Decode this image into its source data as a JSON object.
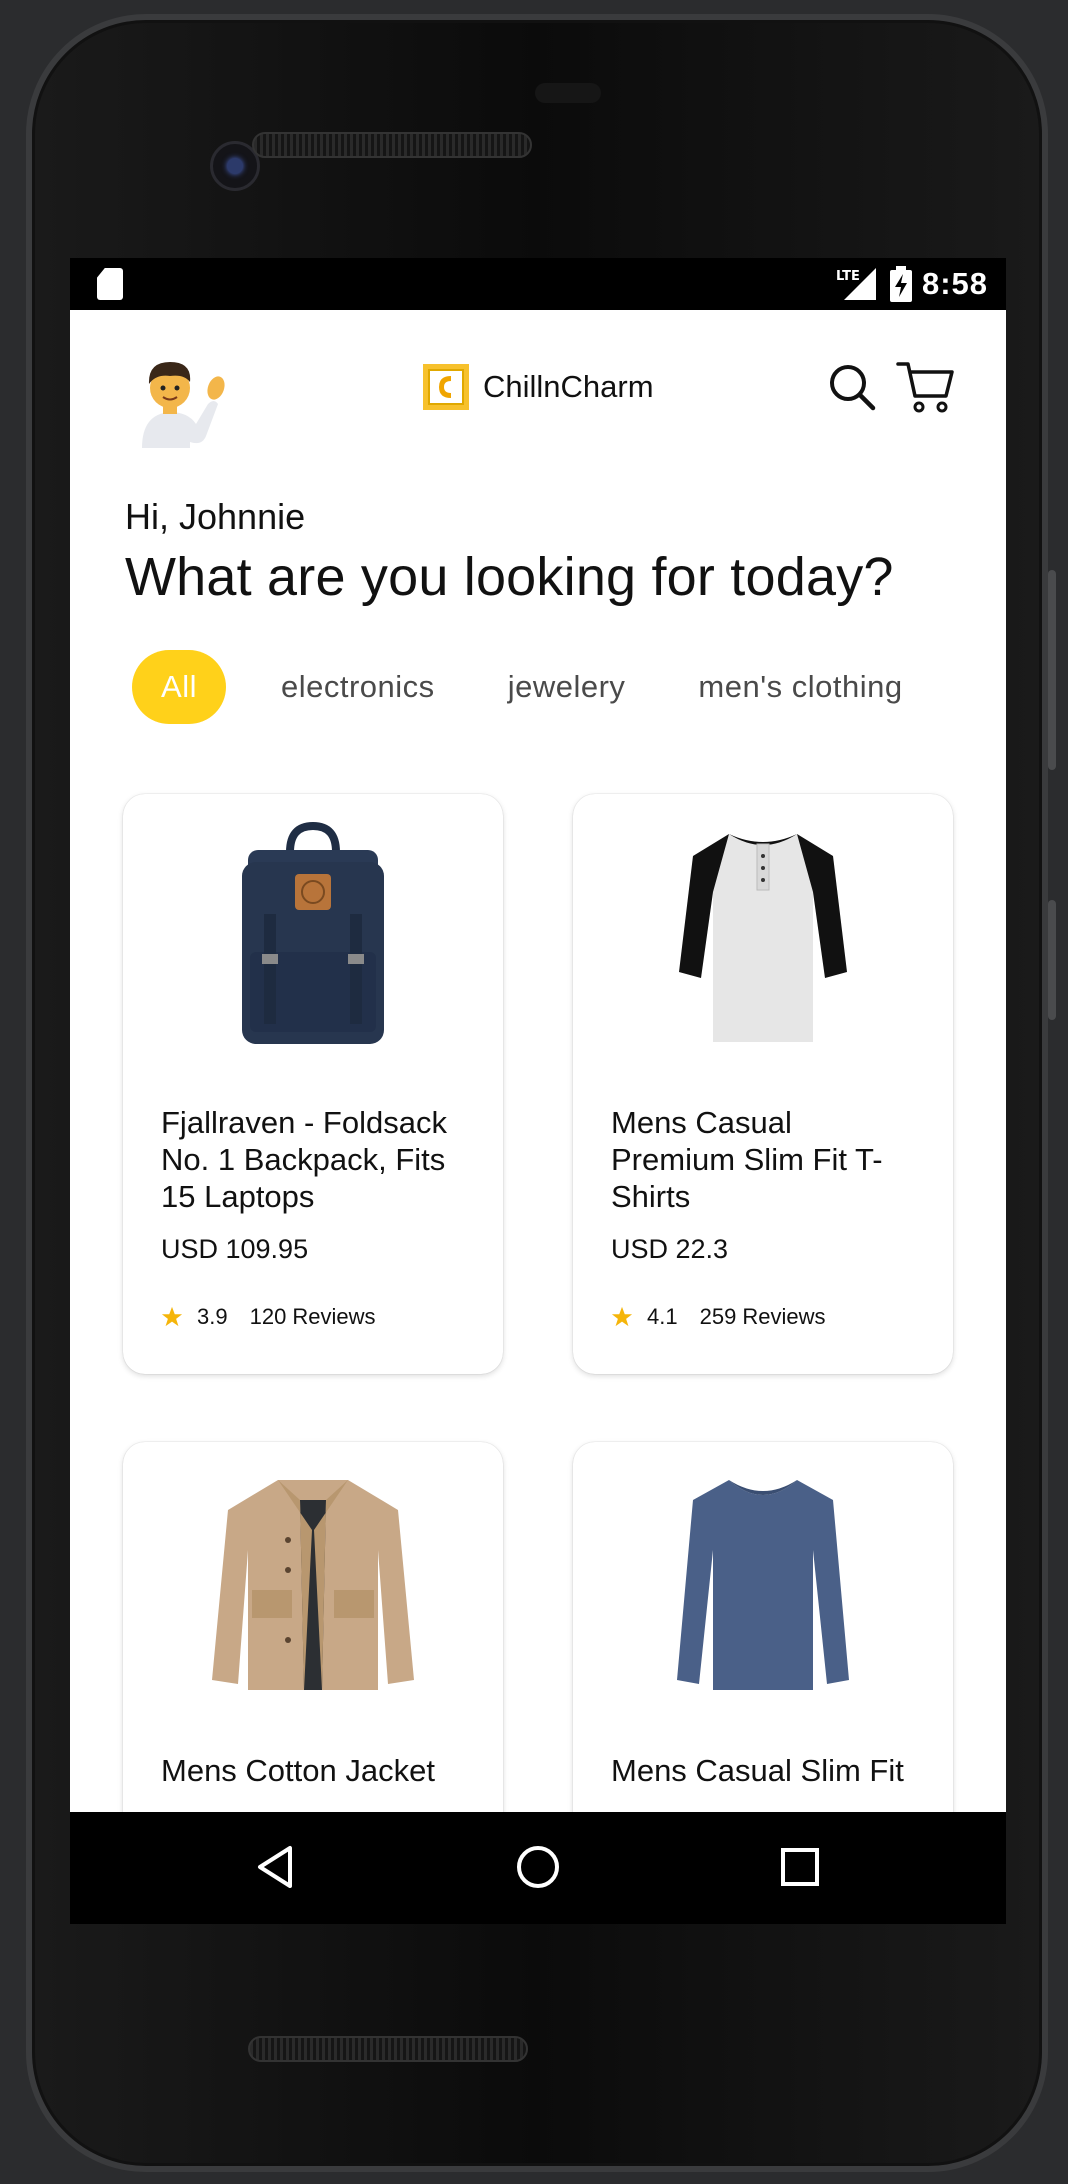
{
  "status_bar": {
    "network": "LTE",
    "time": "8:58"
  },
  "header": {
    "avatar_icon": "person-waving-icon",
    "brand_name": "ChillnCharm",
    "search_icon": "search-icon",
    "cart_icon": "cart-icon"
  },
  "greeting": "Hi, Johnnie",
  "headline": "What are you looking for today?",
  "categories": [
    {
      "label": "All",
      "active": true
    },
    {
      "label": "electronics",
      "active": false
    },
    {
      "label": "jewelery",
      "active": false
    },
    {
      "label": "men's clothing",
      "active": false
    }
  ],
  "products": [
    {
      "title": "Fjallraven - Foldsack No. 1 Backpack, Fits 15 Laptops",
      "price": "USD 109.95",
      "rating": "3.9",
      "reviews": "120 Reviews",
      "image": "backpack-image"
    },
    {
      "title": "Mens Casual Premium Slim Fit T-Shirts",
      "price": "USD 22.3",
      "rating": "4.1",
      "reviews": "259 Reviews",
      "image": "raglan-tshirt-image"
    },
    {
      "title": "Mens Cotton Jacket",
      "image": "jacket-image"
    },
    {
      "title": "Mens Casual Slim Fit",
      "image": "long-sleeve-shirt-image"
    }
  ],
  "nav": {
    "back_icon": "back-triangle-icon",
    "home_icon": "home-circle-icon",
    "recents_icon": "recents-square-icon"
  },
  "colors": {
    "accent": "#ffd11a",
    "star": "#f5b50a"
  }
}
